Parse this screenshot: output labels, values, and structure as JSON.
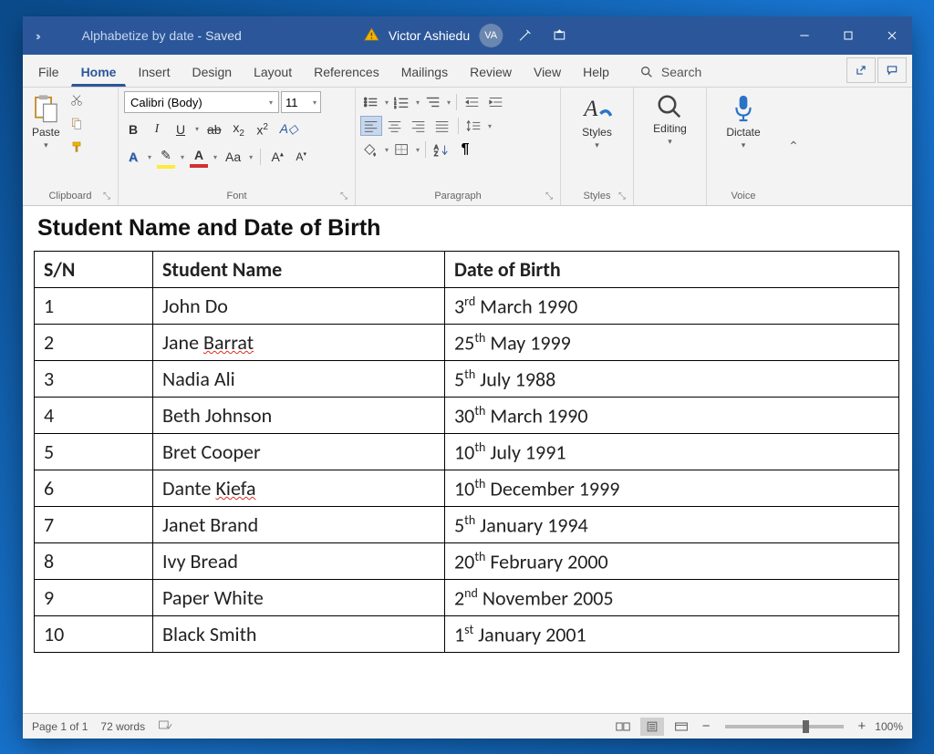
{
  "titlebar": {
    "doc_name": "Alphabetize by date",
    "saved_state": " -  Saved",
    "user_name": "Victor Ashiedu",
    "user_initials": "VA"
  },
  "menu": {
    "tabs": [
      "File",
      "Home",
      "Insert",
      "Design",
      "Layout",
      "References",
      "Mailings",
      "Review",
      "View",
      "Help"
    ],
    "active_index": 1,
    "search_label": "Search"
  },
  "ribbon": {
    "font_name": "Calibri (Body)",
    "font_size": "11",
    "clipboard_label": "Clipboard",
    "paste_label": "Paste",
    "font_label": "Font",
    "paragraph_label": "Paragraph",
    "styles_label": "Styles",
    "editing_label": "Editing",
    "dictate_label": "Dictate",
    "voice_label": "Voice"
  },
  "document": {
    "heading": "Student Name and Date of Birth",
    "columns": [
      "S/N",
      "Student Name",
      "Date of Birth"
    ],
    "rows": [
      {
        "sn": "1",
        "name": "John Do",
        "name_wavy": false,
        "dob_day": "3",
        "dob_ord": "rd",
        "dob_rest": " March 1990"
      },
      {
        "sn": "2",
        "name": "Jane Barrat",
        "name_wavy": true,
        "wavy_part": "Barrat",
        "dob_day": "25",
        "dob_ord": "th",
        "dob_rest": " May 1999"
      },
      {
        "sn": "3",
        "name": "Nadia Ali",
        "name_wavy": false,
        "dob_day": "5",
        "dob_ord": "th",
        "dob_rest": " July 1988"
      },
      {
        "sn": "4",
        "name": "Beth Johnson",
        "name_wavy": false,
        "dob_day": "30",
        "dob_ord": "th",
        "dob_rest": " March 1990"
      },
      {
        "sn": "5",
        "name": "Bret Cooper",
        "name_wavy": false,
        "dob_day": "10",
        "dob_ord": "th",
        "dob_rest": " July 1991"
      },
      {
        "sn": "6",
        "name": "Dante Kiefa",
        "name_wavy": true,
        "wavy_part": "Kiefa",
        "dob_day": "10",
        "dob_ord": "th",
        "dob_rest": " December 1999"
      },
      {
        "sn": "7",
        "name": "Janet Brand",
        "name_wavy": false,
        "dob_day": "5",
        "dob_ord": "th",
        "dob_rest": " January 1994"
      },
      {
        "sn": "8",
        "name": "Ivy Bread",
        "name_wavy": false,
        "dob_day": "20",
        "dob_ord": "th",
        "dob_rest": " February 2000"
      },
      {
        "sn": "9",
        "name": "Paper White",
        "name_wavy": false,
        "dob_day": "2",
        "dob_ord": "nd",
        "dob_rest": " November 2005"
      },
      {
        "sn": "10",
        "name": "Black Smith",
        "name_wavy": false,
        "dob_day": "1",
        "dob_ord": "st",
        "dob_rest": " January 2001"
      }
    ]
  },
  "statusbar": {
    "page": "Page 1 of 1",
    "words": "72 words",
    "zoom": "100%"
  }
}
